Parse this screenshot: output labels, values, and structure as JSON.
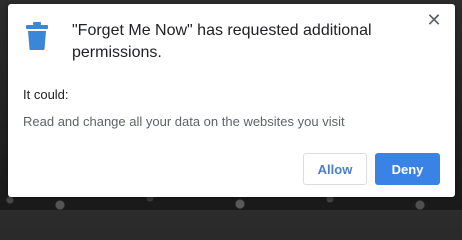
{
  "dialog": {
    "title": "\"Forget Me Now\" has requested additional permissions.",
    "section_label": "It could:",
    "permissions": [
      "Read and change all your data on the websites you visit"
    ],
    "close_label": "✕",
    "allow_label": "Allow",
    "deny_label": "Deny",
    "icon": "trash-can-icon"
  },
  "colors": {
    "icon_blue": "#3a86d8",
    "primary_button": "#3b82e6",
    "allow_text": "#4a7fcf"
  }
}
